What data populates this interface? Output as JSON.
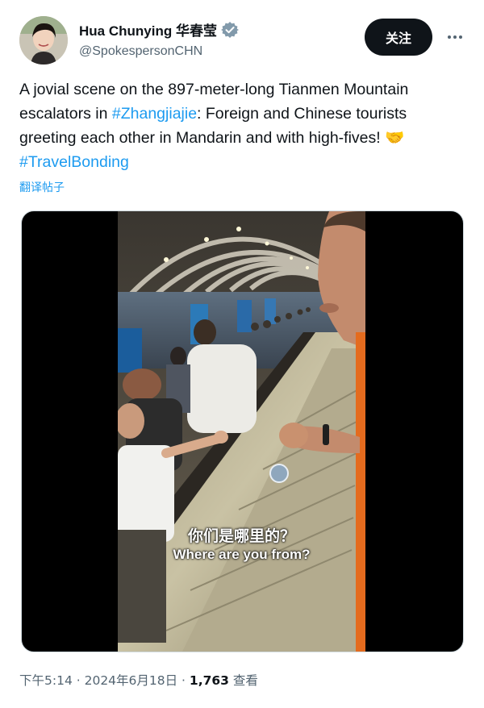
{
  "author": {
    "display_name": "Hua Chunying 华春莹",
    "handle": "@SpokespersonCHN",
    "avatar_icon": "user-avatar",
    "verified_icon": "verified-badge-icon"
  },
  "actions": {
    "follow_label": "关注",
    "more_icon": "more-horizontal-icon"
  },
  "tweet": {
    "text_1": "A jovial scene on the 897-meter-long Tianmen Mountain escalators in ",
    "hashtag_1": "#Zhangjiajie",
    "text_2": ": Foreign and Chinese tourists greeting each other in Mandarin and with high-fives! ",
    "emoji": "🤝",
    "hashtag_2": "#TravelBonding",
    "translate_label": "翻译帖子"
  },
  "video": {
    "subtitle_cn": "你们是哪里的？",
    "subtitle_en": "Where are you from?"
  },
  "meta": {
    "time": "下午5:14",
    "sep1": " · ",
    "date": "2024年6月18日",
    "sep2": " · ",
    "views_count": "1,763",
    "views_label": " 查看"
  },
  "colors": {
    "accent": "#1d9bf0",
    "text": "#0f1419",
    "muted": "#536471",
    "button_bg": "#0f1419"
  }
}
